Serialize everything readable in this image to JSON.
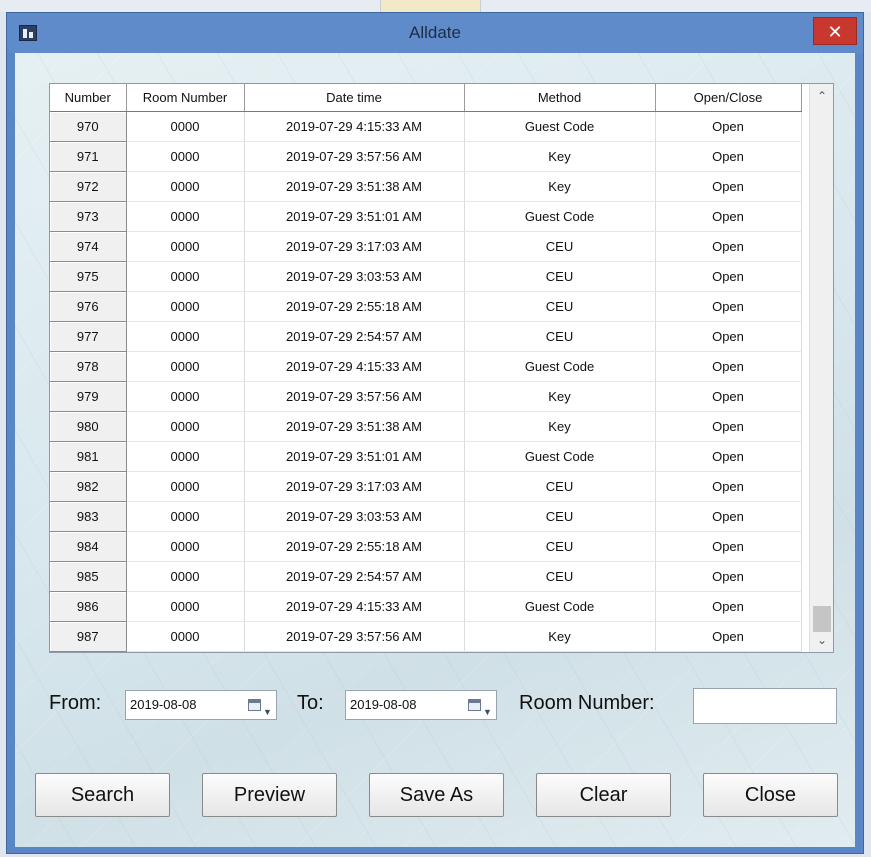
{
  "window": {
    "title": "Alldate",
    "close_glyph": "✕",
    "icon": "app-icon"
  },
  "table": {
    "headers": [
      "Number",
      "Room Number",
      "Date time",
      "Method",
      "Open/Close"
    ],
    "rows": [
      [
        "970",
        "0000",
        "2019-07-29 4:15:33 AM",
        "Guest Code",
        "Open"
      ],
      [
        "971",
        "0000",
        "2019-07-29 3:57:56 AM",
        "Key",
        "Open"
      ],
      [
        "972",
        "0000",
        "2019-07-29 3:51:38 AM",
        "Key",
        "Open"
      ],
      [
        "973",
        "0000",
        "2019-07-29 3:51:01 AM",
        "Guest Code",
        "Open"
      ],
      [
        "974",
        "0000",
        "2019-07-29 3:17:03 AM",
        "CEU",
        "Open"
      ],
      [
        "975",
        "0000",
        "2019-07-29 3:03:53 AM",
        "CEU",
        "Open"
      ],
      [
        "976",
        "0000",
        "2019-07-29 2:55:18 AM",
        "CEU",
        "Open"
      ],
      [
        "977",
        "0000",
        "2019-07-29 2:54:57 AM",
        "CEU",
        "Open"
      ],
      [
        "978",
        "0000",
        "2019-07-29 4:15:33 AM",
        "Guest Code",
        "Open"
      ],
      [
        "979",
        "0000",
        "2019-07-29 3:57:56 AM",
        "Key",
        "Open"
      ],
      [
        "980",
        "0000",
        "2019-07-29 3:51:38 AM",
        "Key",
        "Open"
      ],
      [
        "981",
        "0000",
        "2019-07-29 3:51:01 AM",
        "Guest Code",
        "Open"
      ],
      [
        "982",
        "0000",
        "2019-07-29 3:17:03 AM",
        "CEU",
        "Open"
      ],
      [
        "983",
        "0000",
        "2019-07-29 3:03:53 AM",
        "CEU",
        "Open"
      ],
      [
        "984",
        "0000",
        "2019-07-29 2:55:18 AM",
        "CEU",
        "Open"
      ],
      [
        "985",
        "0000",
        "2019-07-29 2:54:57 AM",
        "CEU",
        "Open"
      ],
      [
        "986",
        "0000",
        "2019-07-29 4:15:33 AM",
        "Guest Code",
        "Open"
      ],
      [
        "987",
        "0000",
        "2019-07-29 3:57:56 AM",
        "Key",
        "Open"
      ]
    ],
    "scroll_up_glyph": "⌃",
    "scroll_down_glyph": "⌄"
  },
  "filters": {
    "from_label": "From:",
    "from_value": "2019-08-08",
    "to_label": "To:",
    "to_value": "2019-08-08",
    "room_label": "Room Number:",
    "room_value": "",
    "dropdown_glyph": "▼"
  },
  "buttons": {
    "search": "Search",
    "preview": "Preview",
    "save_as": "Save As",
    "clear": "Clear",
    "close": "Close"
  },
  "colors": {
    "titlebar": "#5f8bcb",
    "close_button": "#c8382e",
    "window_bg": "#e6f0f3"
  }
}
